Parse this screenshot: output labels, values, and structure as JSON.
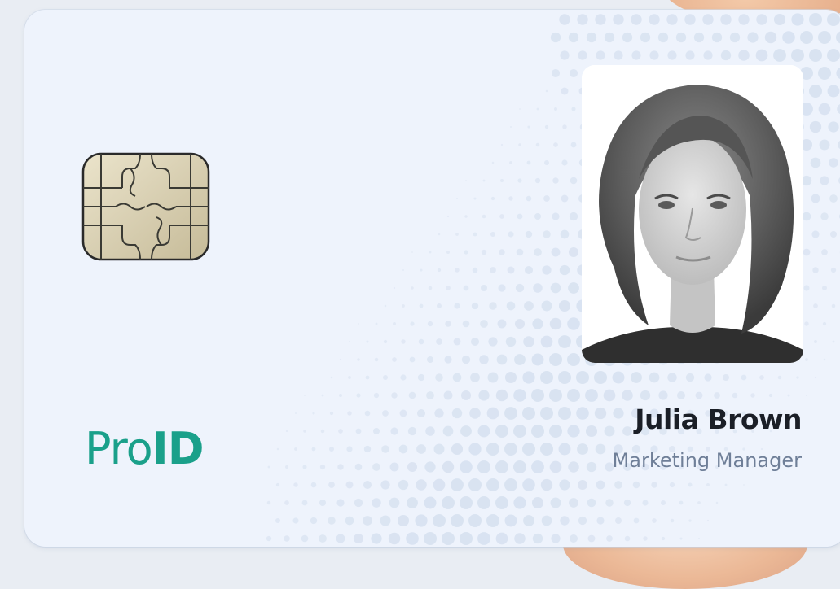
{
  "card": {
    "logo_light": "Pro",
    "logo_bold": "ID",
    "holder_name": "Julia Brown",
    "holder_role": "Marketing Manager"
  },
  "colors": {
    "card_background": "#eef3fc",
    "logo_accent": "#1aa08a",
    "name_text": "#1b1f27",
    "role_text": "#6f7f98",
    "chip_gold": "#d8cfb2",
    "halftone_dots": "#d3deee"
  },
  "icons": {
    "chip": "smart-card-chip-icon",
    "photo": "holder-photo"
  }
}
